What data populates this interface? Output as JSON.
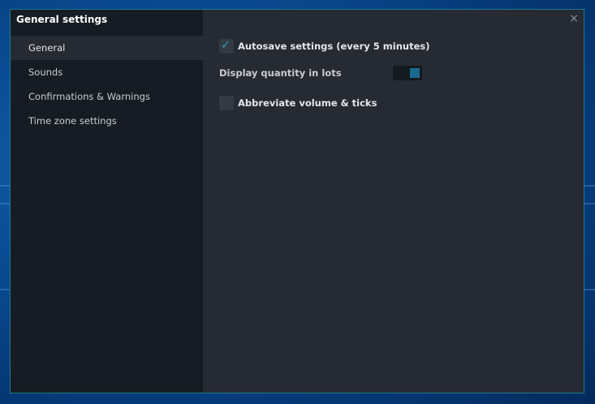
{
  "window": {
    "title": "General settings",
    "close_glyph": "×"
  },
  "sidebar": {
    "items": [
      {
        "label": "General",
        "active": true
      },
      {
        "label": "Sounds",
        "active": false
      },
      {
        "label": "Confirmations & Warnings",
        "active": false
      },
      {
        "label": "Time zone settings",
        "active": false
      }
    ]
  },
  "settings": {
    "autosave": {
      "label": "Autosave settings (every 5 minutes)",
      "checked": true
    },
    "display_lots": {
      "label": "Display quantity in lots",
      "enabled": true
    },
    "abbreviate": {
      "label": "Abbreviate volume & ticks",
      "checked": false
    }
  },
  "colors": {
    "accent": "#2aa3c0",
    "toggle_knob": "#1a6c8e",
    "sidebar_bg": "#161c23",
    "content_bg": "#252a33"
  }
}
